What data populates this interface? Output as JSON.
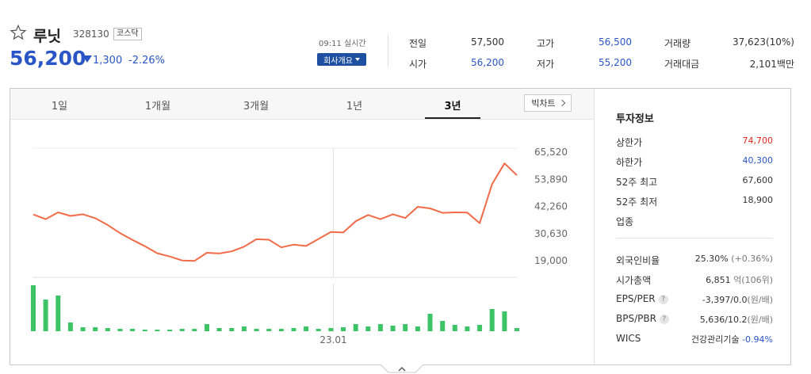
{
  "header": {
    "name": "루닛",
    "code": "328130",
    "market": "코스닥",
    "price": "56,200",
    "change": "1,300",
    "change_rate": "-2.26%",
    "time": "09:11 실시간",
    "company_button": "회사개요"
  },
  "summary": {
    "prev_label": "전일",
    "prev_value": "57,500",
    "open_label": "시가",
    "open_value": "56,200",
    "high_label": "고가",
    "high_value": "56,500",
    "low_label": "저가",
    "low_value": "55,200",
    "volume_label": "거래량",
    "volume_value": "37,623(10%)",
    "amount_label": "거래대금",
    "amount_value": "2,101백만"
  },
  "tabs": [
    "1일",
    "1개월",
    "3개월",
    "1년",
    "3년"
  ],
  "big_chart_label": "빅차트",
  "chart_data": {
    "type": "line",
    "y_ticks": [
      "65,520",
      "53,890",
      "42,260",
      "30,630",
      "19,000"
    ],
    "ylim": [
      19000,
      65520
    ],
    "x_tick": "23.01",
    "price_series": [
      38800,
      36800,
      39700,
      38200,
      38900,
      37200,
      34300,
      30800,
      27900,
      25200,
      22200,
      20800,
      19100,
      18900,
      22400,
      22100,
      23000,
      25000,
      28200,
      28000,
      24700,
      25900,
      25300,
      28300,
      31300,
      31100,
      35900,
      38600,
      36800,
      38900,
      37300,
      42100,
      41400,
      39500,
      39700,
      39600,
      35100,
      51800,
      60700,
      55600
    ],
    "volume_series": [
      58,
      40,
      45,
      11,
      5,
      5,
      4,
      3,
      3,
      2,
      2,
      2,
      3,
      3,
      9,
      4,
      4,
      6,
      3,
      3,
      3,
      4,
      6,
      3,
      4,
      5,
      9,
      6,
      9,
      7,
      9,
      6,
      22,
      13,
      8,
      6,
      8,
      28,
      25,
      4
    ]
  },
  "investment_info": {
    "title": "투자정보",
    "upper_limit_label": "상한가",
    "upper_limit": "74,700",
    "lower_limit_label": "하한가",
    "lower_limit": "40,300",
    "high52_label": "52주 최고",
    "high52": "67,600",
    "low52_label": "52주 최저",
    "low52": "18,900",
    "industry_label": "업종",
    "foreign_label": "외국인비율",
    "foreign": "25.30%",
    "foreign_change": "(+0.36%)",
    "market_cap_label": "시가총액",
    "market_cap": "6,851",
    "market_cap_unit": "억(106위)",
    "eps_label": "EPS/PER",
    "eps": "-3,397/0.0",
    "eps_unit": "(원/배)",
    "bps_label": "BPS/PBR",
    "bps": "5,636/10.2",
    "bps_unit": "(원/배)",
    "wics_label": "WICS",
    "wics": "건강관리기술",
    "wics_change": "-0.94%",
    "help_glyph": "?"
  },
  "colors": {
    "up": "#e0281e",
    "down": "#2a55c6",
    "line": "#f26b47",
    "volume": "#3cc466"
  }
}
